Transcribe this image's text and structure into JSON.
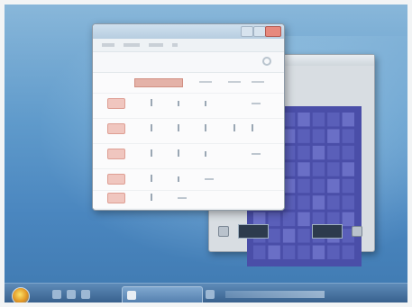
{
  "colors": {
    "desktop": "#4a86bf",
    "grid_fill": "#4a4ea8",
    "accent_red": "#e4b2a8",
    "taskbar": "#2f5784"
  },
  "icons": {
    "start": "windows-orb-icon",
    "close": "close-icon",
    "settings": "gear-icon"
  },
  "back_window": {
    "grid": {
      "rows": 9,
      "cols": 7
    }
  },
  "front_window": {
    "menu_count": 4,
    "rows": 5
  }
}
